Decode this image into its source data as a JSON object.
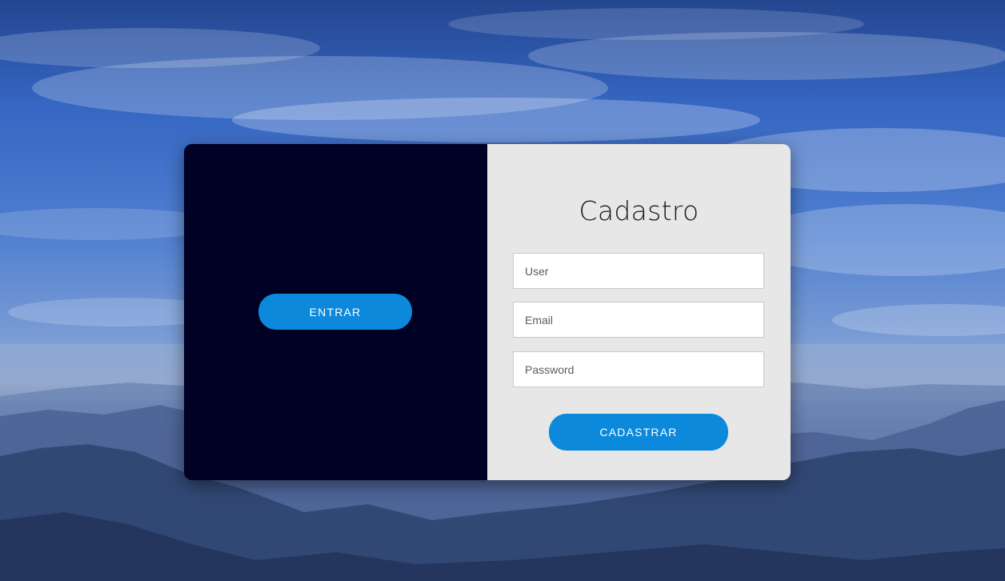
{
  "login_panel": {
    "enter_button_label": "ENTRAR"
  },
  "signup_panel": {
    "title": "Cadastro",
    "user_field": {
      "placeholder": "User",
      "value": ""
    },
    "email_field": {
      "placeholder": "Email",
      "value": ""
    },
    "password_field": {
      "placeholder": "Password",
      "value": ""
    },
    "submit_button_label": "CADASTRAR"
  },
  "colors": {
    "login_panel_bg": "#010125",
    "signup_panel_bg": "#e7e7e7",
    "button_accent": "#0c89db",
    "sky": "#3566c2"
  }
}
